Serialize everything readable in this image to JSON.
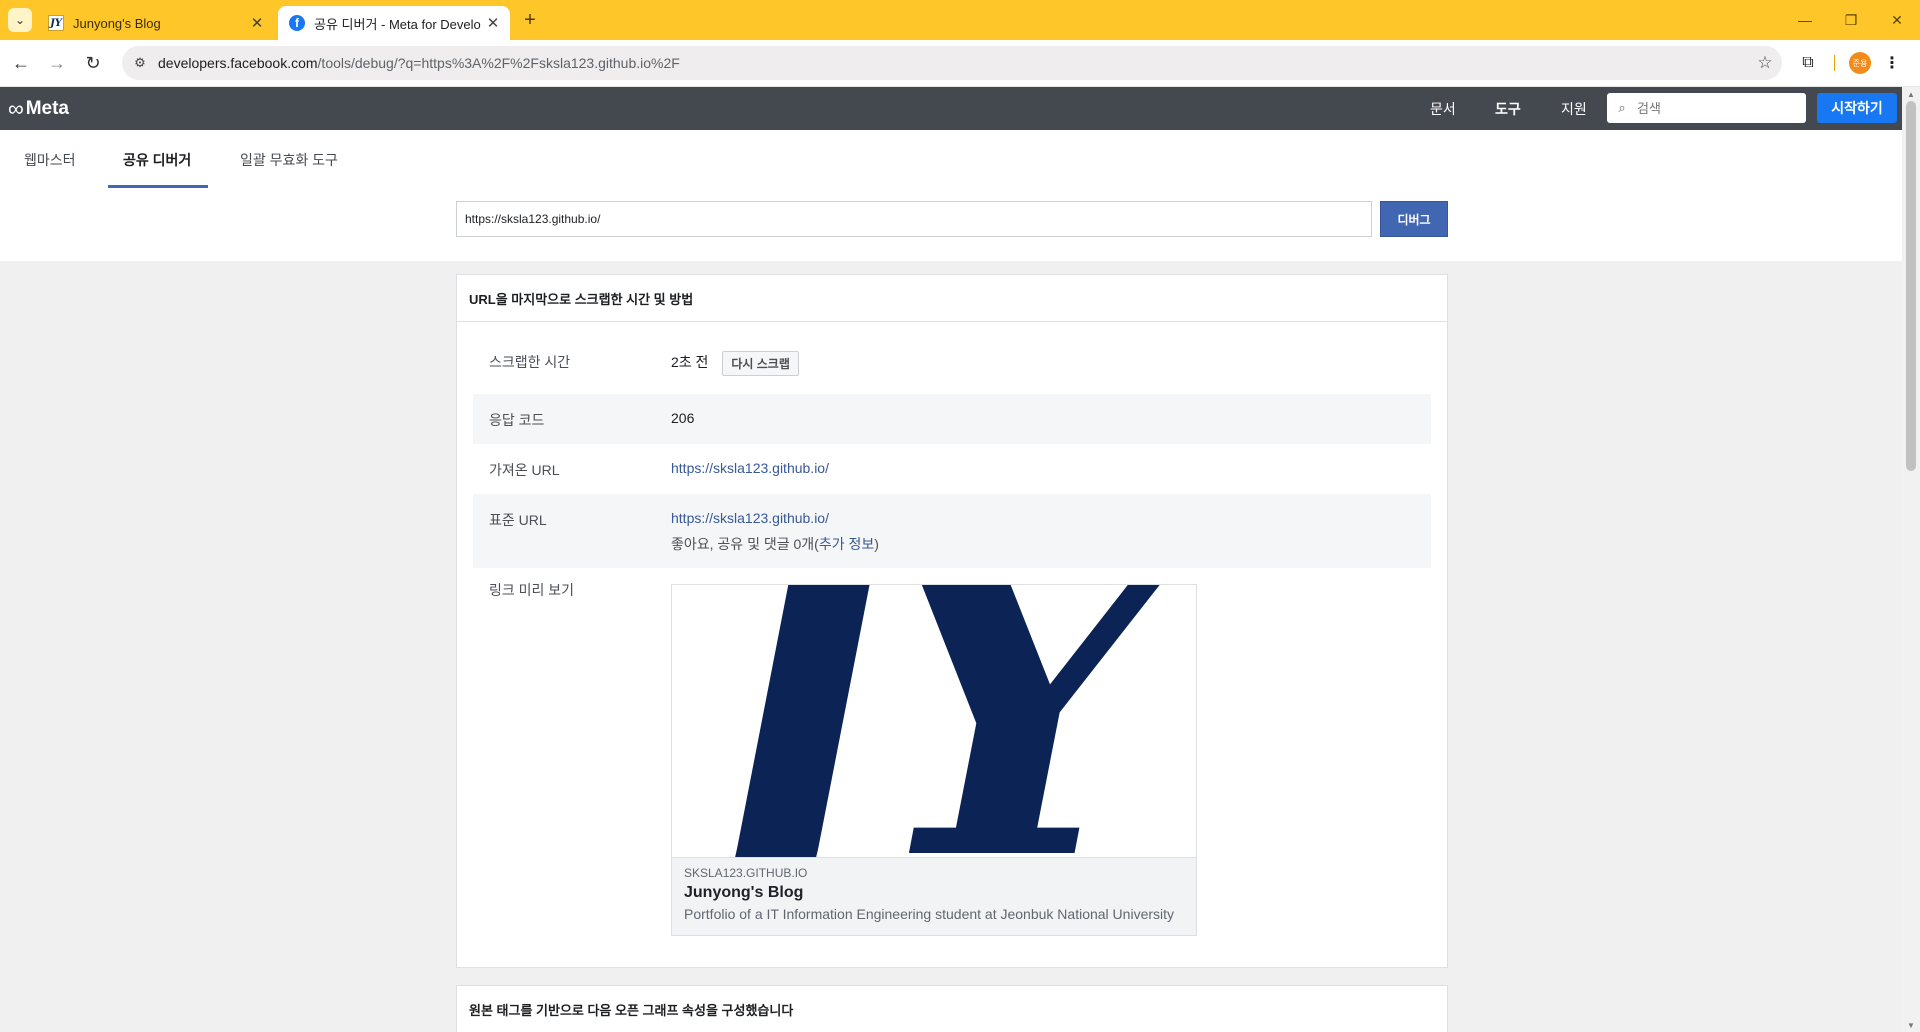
{
  "browser": {
    "tabs": [
      {
        "title": "Junyong's Blog",
        "favicon_text": "JY",
        "active": false
      },
      {
        "title": "공유 디버거 - Meta for Develo",
        "favicon_text": "f",
        "active": true
      }
    ],
    "url_host": "developers.facebook.com",
    "url_path": "/tools/debug/?q=https%3A%2F%2Fsksla123.github.io%2F",
    "profile_initial": "준용",
    "colors": {
      "tabbar": "#ffc629",
      "profile": "#f28b1a"
    }
  },
  "meta_header": {
    "logo_text": "Meta",
    "nav": [
      {
        "label": "문서",
        "active": false
      },
      {
        "label": "도구",
        "active": true
      },
      {
        "label": "지원",
        "active": false
      }
    ],
    "search_placeholder": "검색",
    "start_label": "시작하기",
    "colors": {
      "bar": "#444950",
      "primary": "#1877f2"
    }
  },
  "subnav": {
    "tabs": [
      {
        "label": "웹마스터",
        "active": false
      },
      {
        "label": "공유 디버거",
        "active": true
      },
      {
        "label": "일괄 무효화 도구",
        "active": false
      }
    ]
  },
  "debug_form": {
    "url_value": "https://sksla123.github.io/",
    "button_label": "디버그"
  },
  "scrape_card": {
    "title": "URL을 마지막으로 스크랩한 시간 및 방법",
    "rows": {
      "time": {
        "label": "스크랩한 시간",
        "value": "2초 전",
        "action": "다시 스크랩"
      },
      "response": {
        "label": "응답 코드",
        "value": "206"
      },
      "fetched": {
        "label": "가져온 URL",
        "value": "https://sksla123.github.io/"
      },
      "canonical": {
        "label": "표준 URL",
        "value": "https://sksla123.github.io/",
        "stats_prefix": "좋아요, 공유 및 댓글 0개(",
        "stats_link": "추가 정보",
        "stats_suffix": ")"
      },
      "preview": {
        "label": "링크 미리 보기"
      }
    },
    "link_preview": {
      "image_text": "JY",
      "domain": "SKSLA123.GITHUB.IO",
      "title": "Junyong's Blog",
      "description": "Portfolio of a IT Information Engineering student at Jeonbuk National University"
    }
  },
  "og_card": {
    "title": "원본 태그를 기반으로 다음 오픈 그래프 속성을 구성했습니다"
  }
}
